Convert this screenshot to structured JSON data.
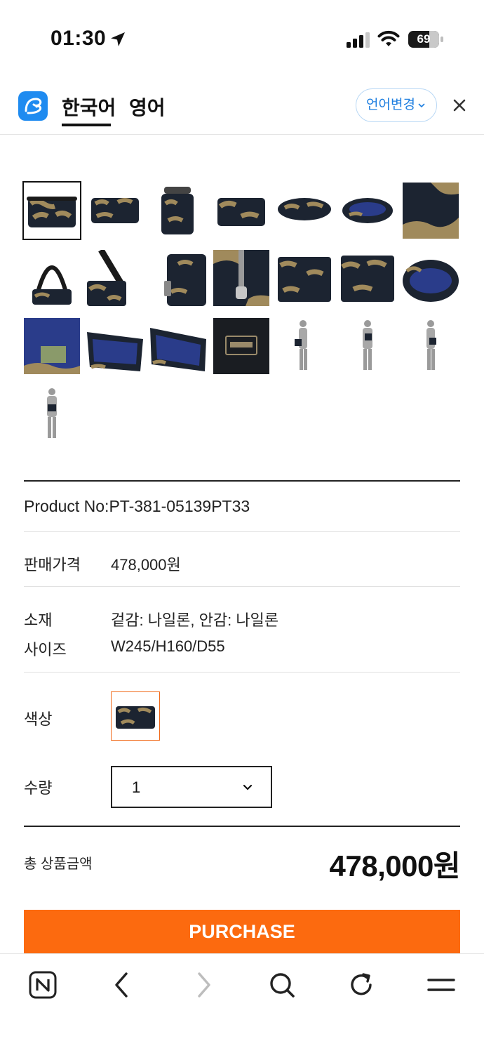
{
  "status_bar": {
    "time": "01:30",
    "battery": "69",
    "battery_level": 0.69
  },
  "translate_header": {
    "tab_korean": "한국어",
    "tab_english": "영어",
    "language_button": "언어변경"
  },
  "gallery": {
    "image_count": 22,
    "selected_index": 0
  },
  "product": {
    "product_no": "Product No:PT-381-05139PT33",
    "price_label": "판매가격",
    "price_value": "478,000원",
    "material_label": "소재",
    "material_value": "겉감: 나일론, 안감: 나일론",
    "size_label": "사이즈",
    "size_value": "W245/H160/D55",
    "color_label": "색상",
    "quantity_label": "수량",
    "quantity_value": "1"
  },
  "total": {
    "label": "총 상품금액",
    "value": "478,000원"
  },
  "purchase_button": "PURCHASE",
  "colors": {
    "accent": "#fc6a0f",
    "swatch_border": "#f06a1a",
    "link_blue": "#1f7fe0",
    "camo_dark": "#1c2431",
    "camo_tan": "#a08a5c"
  }
}
